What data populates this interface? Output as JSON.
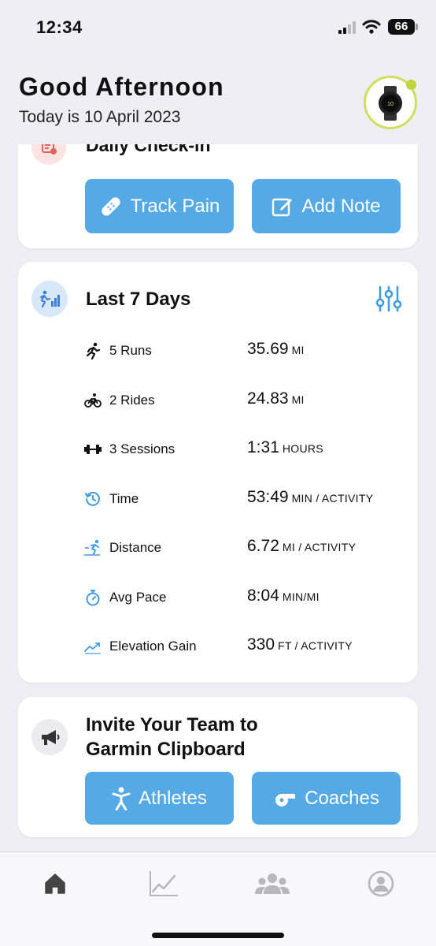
{
  "status_bar": {
    "time": "12:34",
    "battery": "66"
  },
  "header": {
    "greeting": "Good Afternoon",
    "date_text": "Today is 10 April 2023",
    "avatar_icon": "watch-icon"
  },
  "checkin": {
    "title": "Daily Check-in",
    "icon": "clipboard-heart-icon",
    "buttons": [
      {
        "label": "Track Pain",
        "icon": "bandage-icon"
      },
      {
        "label": "Add Note",
        "icon": "note-edit-icon"
      }
    ]
  },
  "last7": {
    "title": "Last 7 Days",
    "icon": "activity-chart-icon",
    "filter_icon": "sliders-icon",
    "stats": [
      {
        "label": "5 Runs",
        "value": "35.69",
        "unit": "MI",
        "icon": "runner-icon"
      },
      {
        "label": "2 Rides",
        "value": "24.83",
        "unit": "MI",
        "icon": "bike-icon"
      },
      {
        "label": "3 Sessions",
        "value": "1:31",
        "unit": "HOURS",
        "icon": "dumbbell-icon"
      },
      {
        "label": "Time",
        "value": "53:49",
        "unit": "MIN / ACTIVITY",
        "icon": "clock-history-icon"
      },
      {
        "label": "Distance",
        "value": "6.72",
        "unit": "MI / ACTIVITY",
        "icon": "sprint-icon"
      },
      {
        "label": "Avg Pace",
        "value": "8:04",
        "unit": "MIN/MI",
        "icon": "stopwatch-icon"
      },
      {
        "label": "Elevation Gain",
        "value": "330",
        "unit": "FT / ACTIVITY",
        "icon": "trend-up-icon"
      }
    ]
  },
  "invite": {
    "title_line1": "Invite Your Team to",
    "title_line2": "Garmin Clipboard",
    "icon": "megaphone-icon",
    "buttons": [
      {
        "label": "Athletes",
        "icon": "person-icon"
      },
      {
        "label": "Coaches",
        "icon": "whistle-icon"
      }
    ]
  },
  "tabs": [
    {
      "name": "home",
      "icon": "home-icon",
      "active": true
    },
    {
      "name": "stats",
      "icon": "line-chart-icon",
      "active": false
    },
    {
      "name": "team",
      "icon": "group-icon",
      "active": false
    },
    {
      "name": "profile",
      "icon": "profile-icon",
      "active": false
    }
  ],
  "colors": {
    "accent": "#55a9e5",
    "background": "#efeef4",
    "avatar_ring": "#d2de5a"
  }
}
